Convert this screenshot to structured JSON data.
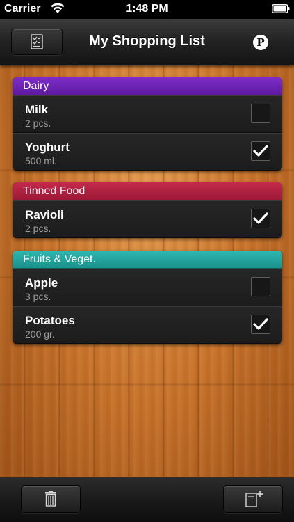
{
  "status_bar": {
    "carrier": "Carrier",
    "time": "1:48 PM"
  },
  "nav": {
    "title": "My Shopping List",
    "badge": "P"
  },
  "sections": [
    {
      "title": "Dairy",
      "color": "#6a1fb0",
      "items": [
        {
          "name": "Milk",
          "qty": "2 pcs.",
          "checked": false
        },
        {
          "name": "Yoghurt",
          "qty": "500 ml.",
          "checked": true
        }
      ]
    },
    {
      "title": "Tinned Food",
      "color": "#b01f3e",
      "items": [
        {
          "name": "Ravioli",
          "qty": "2 pcs.",
          "checked": true
        }
      ]
    },
    {
      "title": "Fruits & Veget.",
      "color": "#22a6a0",
      "items": [
        {
          "name": "Apple",
          "qty": "3 pcs.",
          "checked": false
        },
        {
          "name": "Potatoes",
          "qty": "200 gr.",
          "checked": true
        }
      ]
    }
  ],
  "icons": {
    "nav_left": "checklist-icon",
    "toolbar_left": "trash-icon",
    "toolbar_right": "add-item-icon"
  }
}
